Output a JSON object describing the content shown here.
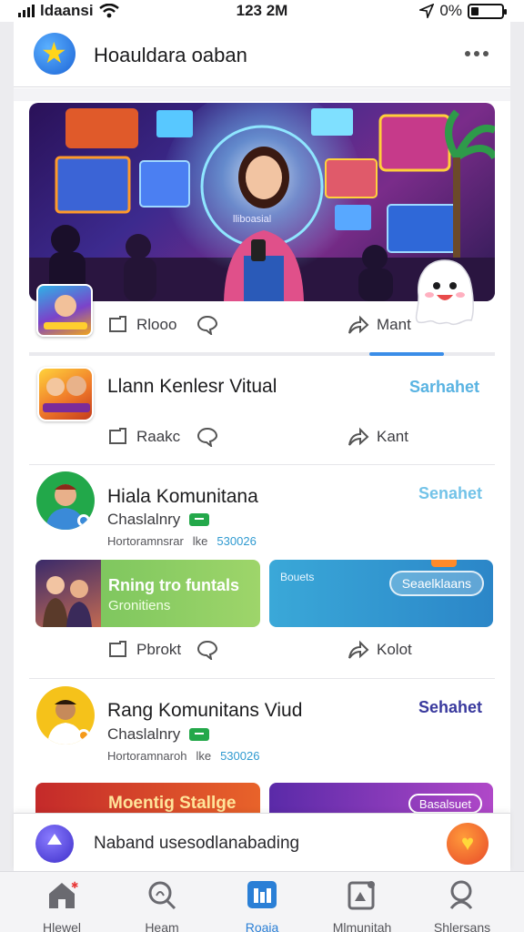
{
  "status_bar": {
    "carrier": "ldaansi",
    "time": "123 2M",
    "battery_percent": "0%"
  },
  "header": {
    "title": "Hoauldara oaban",
    "logo_icon": "star-icon",
    "more_icon": "more-dots-icon"
  },
  "hero": {
    "label": "lliboasial",
    "progress": 0.16
  },
  "hero_actions": {
    "first": "Rlooo",
    "share": "Mant"
  },
  "items": [
    {
      "title": "Llann Kenlesr Vitual",
      "link": "Sarhahet",
      "link_color": "#59b3e2",
      "actions": {
        "first": "Raakc",
        "share": "Kant"
      }
    },
    {
      "title": "Hiala Komunitana",
      "link": "Senahet",
      "link_color": "#73c3e8",
      "subtitle": "Chaslalnry",
      "meta_left": "Hortoramnsrar",
      "meta_mid": "lke",
      "meta_num": "530026"
    },
    {
      "title": "Rang Komunitans Viud",
      "link": "Sehahet",
      "link_color": "#3a3a9e",
      "subtitle": "Chaslalnry",
      "meta_left": "Hortoramnaroh",
      "meta_mid": "lke",
      "meta_num": "530026"
    }
  ],
  "banners": {
    "green": {
      "title": "Rning tro funtals",
      "subtitle": "Gronitiens"
    },
    "blue": {
      "label": "Bouets",
      "button": "Seaelklaans"
    },
    "red": {
      "title": "Moentig Stallge"
    },
    "purple": {
      "button": "Basalsuet"
    }
  },
  "banner_actions": {
    "first": "Pbrokt",
    "share": "Kolot"
  },
  "composer": {
    "placeholder": "Naband usesodlanabading"
  },
  "nav": [
    {
      "label": "Hlewel",
      "icon": "home-icon"
    },
    {
      "label": "Heam",
      "icon": "search-chat-icon"
    },
    {
      "label": "Roaia",
      "icon": "feed-icon",
      "active": true
    },
    {
      "label": "Mlmunitah",
      "icon": "community-icon"
    },
    {
      "label": "Shlersans",
      "icon": "profile-search-icon"
    }
  ],
  "colors": {
    "accent": "#2a7fd6",
    "link_blue": "#59b3e2",
    "link_navy": "#3a3a9e"
  }
}
